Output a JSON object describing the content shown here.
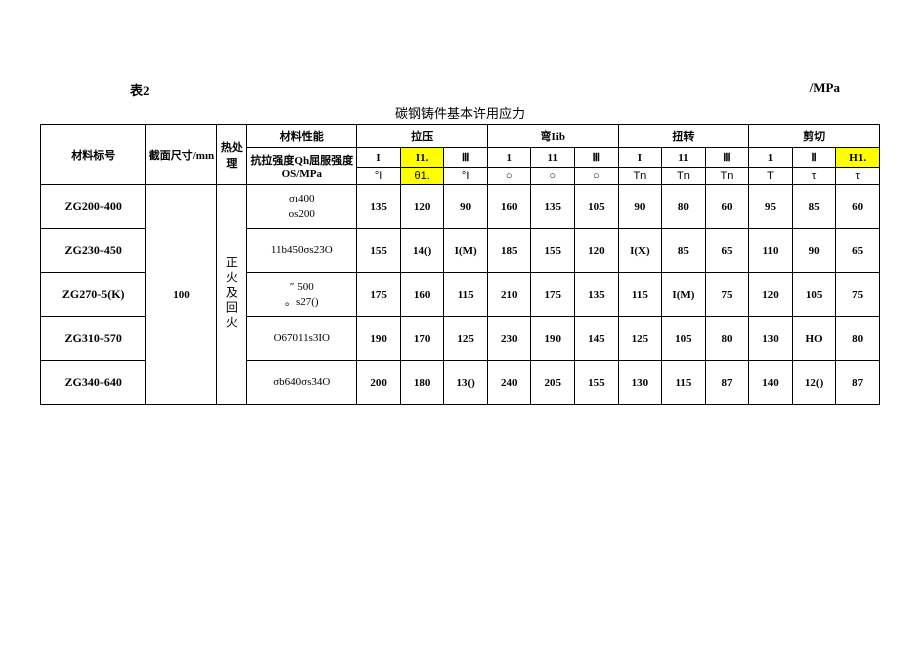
{
  "meta": {
    "left": "表2",
    "right": "/MPa",
    "title": "碳钢铸件基本许用应力"
  },
  "head": {
    "c0": "材料标号",
    "c1": "截面尺寸/mın",
    "c2": "热处理",
    "c3": "材料性能",
    "c3b": "抗拉强度Qh屈服强度OS/MPa",
    "g1": "拉压",
    "g2": "弯Iib",
    "g3": "扭转",
    "g4": "剪切",
    "h": [
      "I",
      "I1.",
      "Ⅲ",
      "1",
      "11",
      "Ⅲ",
      "I",
      "11",
      "Ⅲ",
      "1",
      "Ⅱ",
      "H1."
    ],
    "s": [
      "°I",
      "θ1.",
      "°I",
      "○",
      "○",
      "○",
      "Tn",
      "Tn",
      "Tn",
      "T",
      "τ",
      "τ"
    ]
  },
  "left": {
    "section": "100",
    "heat": "正火及回火"
  },
  "rows": [
    {
      "mat": "ZG200-400",
      "prop": "σı400\nos200",
      "v": [
        "135",
        "120",
        "90",
        "160",
        "135",
        "105",
        "90",
        "80",
        "60",
        "95",
        "85",
        "60"
      ]
    },
    {
      "mat": "ZG230-450",
      "prop": "11b450σs23O",
      "v": [
        "155",
        "14()",
        "I(M)",
        "185",
        "155",
        "120",
        "I(X)",
        "85",
        "65",
        "110",
        "90",
        "65"
      ]
    },
    {
      "mat": "ZG270-5(K)",
      "prop": "″ 500\n。s27()",
      "v": [
        "175",
        "160",
        "115",
        "210",
        "175",
        "135",
        "115",
        "I(M)",
        "75",
        "120",
        "105",
        "75"
      ]
    },
    {
      "mat": "ZG310-570",
      "prop": "O67011s3IO",
      "v": [
        "190",
        "170",
        "125",
        "230",
        "190",
        "145",
        "125",
        "105",
        "80",
        "130",
        "HO",
        "80"
      ]
    },
    {
      "mat": "ZG340-640",
      "prop": "σb640σs34O",
      "v": [
        "200",
        "180",
        "13()",
        "240",
        "205",
        "155",
        "130",
        "115",
        "87",
        "140",
        "12()",
        "87"
      ]
    }
  ],
  "chart_data": {
    "type": "table",
    "title": "碳钢铸件基本许用应力 /MPa",
    "columns": [
      "材料标号",
      "截面尺寸/mm",
      "热处理",
      "抗拉强度Qh屈服强度OS/MPa",
      "拉压 I",
      "拉压 II",
      "拉压 III",
      "弯 I",
      "弯 II",
      "弯 III",
      "扭转 I",
      "扭转 II",
      "扭转 III",
      "剪切 I",
      "剪切 II",
      "剪切 III"
    ],
    "rows": [
      [
        "ZG200-400",
        "100",
        "正火及回火",
        "σı400 os200",
        "135",
        "120",
        "90",
        "160",
        "135",
        "105",
        "90",
        "80",
        "60",
        "95",
        "85",
        "60"
      ],
      [
        "ZG230-450",
        "100",
        "正火及回火",
        "11b450σs23O",
        "155",
        "14()",
        "I(M)",
        "185",
        "155",
        "120",
        "I(X)",
        "85",
        "65",
        "110",
        "90",
        "65"
      ],
      [
        "ZG270-5(K)",
        "100",
        "正火及回火",
        "″500 。s27()",
        "175",
        "160",
        "115",
        "210",
        "175",
        "135",
        "115",
        "I(M)",
        "75",
        "120",
        "105",
        "75"
      ],
      [
        "ZG310-570",
        "100",
        "正火及回火",
        "O67011s3IO",
        "190",
        "170",
        "125",
        "230",
        "190",
        "145",
        "125",
        "105",
        "80",
        "130",
        "HO",
        "80"
      ],
      [
        "ZG340-640",
        "100",
        "正火及回火",
        "σb640σs34O",
        "200",
        "180",
        "13()",
        "240",
        "205",
        "155",
        "130",
        "115",
        "87",
        "140",
        "12()",
        "87"
      ]
    ]
  }
}
